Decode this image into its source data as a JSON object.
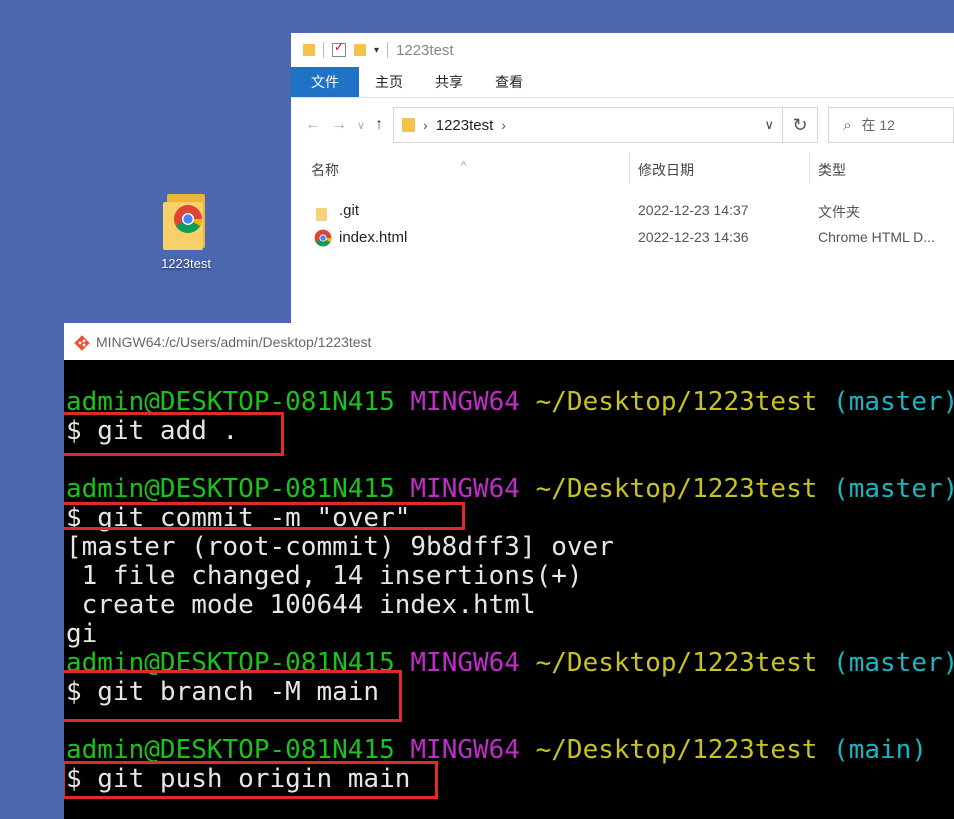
{
  "desktop": {
    "icon_label": "1223test"
  },
  "explorer": {
    "title": "1223test",
    "tabs": [
      "文件",
      "主页",
      "共享",
      "查看"
    ],
    "breadcrumb": "1223test",
    "search_placeholder": "在 12",
    "columns": {
      "name": "名称",
      "date": "修改日期",
      "type": "类型"
    },
    "files": [
      {
        "name": ".git",
        "date": "2022-12-23 14:37",
        "type": "文件夹",
        "icon": "folder-icon"
      },
      {
        "name": "index.html",
        "date": "2022-12-23 14:36",
        "type": "Chrome HTML D...",
        "icon": "chrome-icon"
      }
    ]
  },
  "terminal": {
    "title": "MINGW64:/c/Users/admin/Desktop/1223test",
    "prompt": {
      "user": "admin@DESKTOP-081N415",
      "shell": "MINGW64",
      "path": "~/Desktop/1223test",
      "branch_master": "(master)",
      "branch_main": "(main)"
    },
    "commands": [
      "$ git add .",
      "$ git commit -m \"over\"",
      "$ git branch -M main",
      "$ git push origin main"
    ],
    "output": [
      "[master (root-commit) 9b8dff3] over",
      " 1 file changed, 14 insertions(+)",
      " create mode 100644 index.html",
      "gi"
    ]
  }
}
